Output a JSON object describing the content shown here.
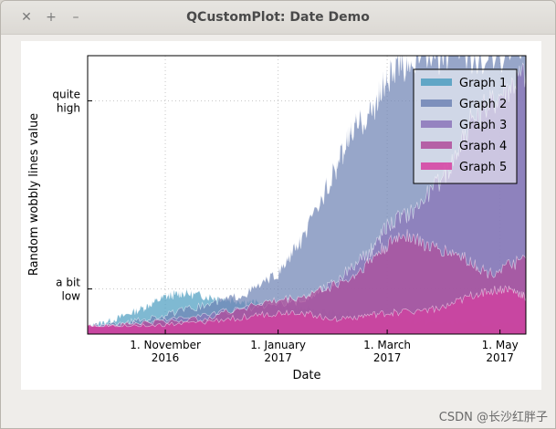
{
  "window": {
    "title": "QCustomPlot: Date Demo",
    "close_glyph": "✕",
    "add_glyph": "+",
    "minimize_glyph": "–"
  },
  "watermark": "CSDN @长沙红胖子",
  "chart_data": {
    "type": "area",
    "xlabel": "Date",
    "ylabel": "Random wobbly lines value",
    "x_ticks": [
      {
        "line1": "1. November",
        "line2": "2016",
        "date": "2016-11-01"
      },
      {
        "line1": "1. January",
        "line2": "2017",
        "date": "2017-01-01"
      },
      {
        "line1": "1. March",
        "line2": "2017",
        "date": "2017-03-01"
      },
      {
        "line1": "1. May",
        "line2": "2017",
        "date": "2017-05-01"
      }
    ],
    "y_ticks": [
      {
        "line1": "quite",
        "line2": "high",
        "value": 60
      },
      {
        "line1": "a bit",
        "line2": "low",
        "value": 10
      }
    ],
    "xlim": [
      "2016-09-20",
      "2017-05-15"
    ],
    "ylim": [
      -2,
      72
    ],
    "grid": true,
    "legend_position": "top-right",
    "series": [
      {
        "name": "Graph 1",
        "color": "#4d9ec0",
        "points": [
          [
            "2016-09-20",
            0
          ],
          [
            "2016-10-05",
            2
          ],
          [
            "2016-10-20",
            5
          ],
          [
            "2016-11-01",
            8
          ],
          [
            "2016-11-10",
            9
          ],
          [
            "2016-11-25",
            8
          ],
          [
            "2016-12-10",
            7
          ],
          [
            "2016-12-25",
            6
          ],
          [
            "2017-01-10",
            5
          ],
          [
            "2017-01-25",
            4
          ],
          [
            "2017-02-10",
            3
          ],
          [
            "2017-03-01",
            2
          ],
          [
            "2017-03-20",
            1
          ],
          [
            "2017-04-10",
            1
          ],
          [
            "2017-05-15",
            0
          ]
        ]
      },
      {
        "name": "Graph 2",
        "color": "#6f84b4",
        "points": [
          [
            "2016-09-20",
            0
          ],
          [
            "2016-10-10",
            1
          ],
          [
            "2016-11-01",
            3
          ],
          [
            "2016-11-25",
            6
          ],
          [
            "2016-12-15",
            9
          ],
          [
            "2017-01-01",
            14
          ],
          [
            "2017-01-15",
            24
          ],
          [
            "2017-02-01",
            42
          ],
          [
            "2017-02-10",
            52
          ],
          [
            "2017-02-20",
            57
          ],
          [
            "2017-03-01",
            66
          ],
          [
            "2017-03-15",
            72
          ],
          [
            "2017-04-10",
            72
          ],
          [
            "2017-05-15",
            72
          ]
        ]
      },
      {
        "name": "Graph 3",
        "color": "#8b74b8",
        "points": [
          [
            "2016-09-20",
            0
          ],
          [
            "2016-10-20",
            1
          ],
          [
            "2016-11-20",
            3
          ],
          [
            "2016-12-20",
            5
          ],
          [
            "2017-01-15",
            7
          ],
          [
            "2017-02-01",
            12
          ],
          [
            "2017-02-20",
            20
          ],
          [
            "2017-03-01",
            27
          ],
          [
            "2017-03-15",
            31
          ],
          [
            "2017-04-01",
            40
          ],
          [
            "2017-04-15",
            54
          ],
          [
            "2017-05-01",
            62
          ],
          [
            "2017-05-15",
            68
          ]
        ]
      },
      {
        "name": "Graph 4",
        "color": "#b04c9a",
        "points": [
          [
            "2016-09-20",
            0
          ],
          [
            "2016-10-20",
            1
          ],
          [
            "2016-11-20",
            2
          ],
          [
            "2016-12-20",
            6
          ],
          [
            "2017-01-15",
            8
          ],
          [
            "2017-02-10",
            13
          ],
          [
            "2017-02-25",
            20
          ],
          [
            "2017-03-10",
            25
          ],
          [
            "2017-03-25",
            21
          ],
          [
            "2017-04-10",
            19
          ],
          [
            "2017-04-25",
            14
          ],
          [
            "2017-05-15",
            18
          ]
        ]
      },
      {
        "name": "Graph 5",
        "color": "#d63fa0",
        "points": [
          [
            "2016-09-20",
            0
          ],
          [
            "2016-10-20",
            0
          ],
          [
            "2016-11-20",
            1
          ],
          [
            "2016-12-20",
            3
          ],
          [
            "2017-01-10",
            4
          ],
          [
            "2017-02-01",
            2
          ],
          [
            "2017-02-20",
            3
          ],
          [
            "2017-03-10",
            4
          ],
          [
            "2017-04-01",
            5
          ],
          [
            "2017-04-20",
            9
          ],
          [
            "2017-05-05",
            10
          ],
          [
            "2017-05-15",
            8
          ]
        ]
      }
    ]
  }
}
